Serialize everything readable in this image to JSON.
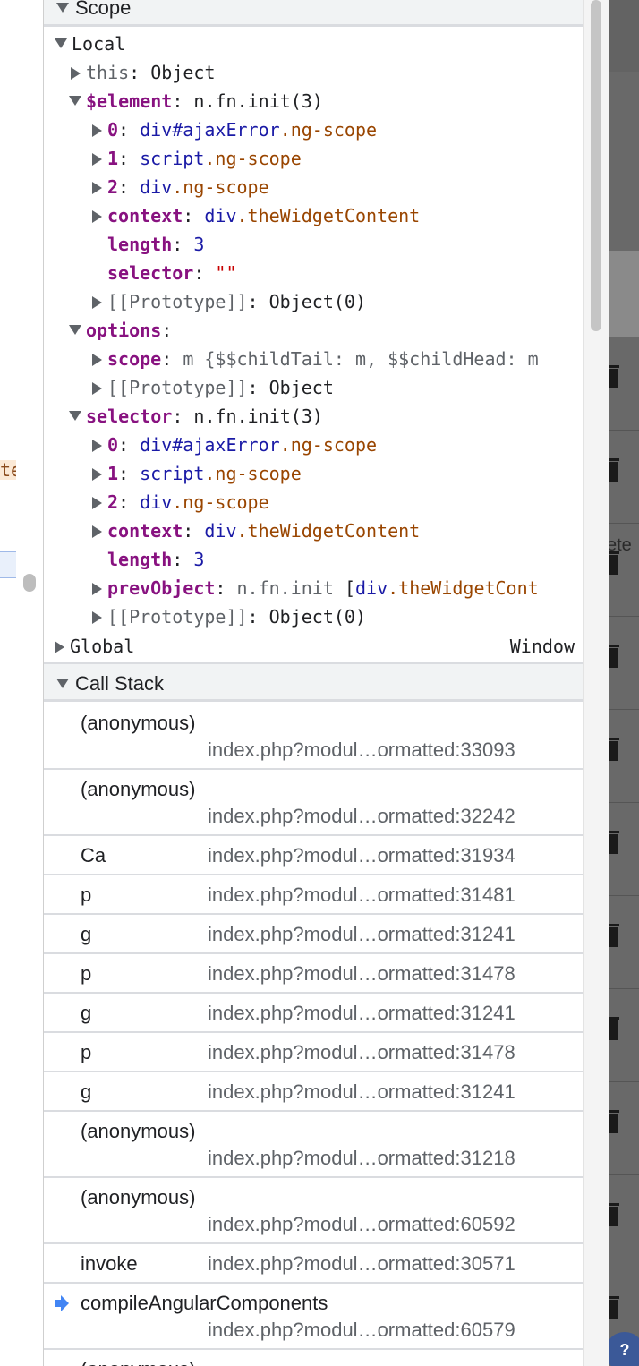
{
  "scope": {
    "title": "Scope",
    "local": {
      "label": "Local",
      "this": {
        "key": "this",
        "value": "Object"
      },
      "element": {
        "key": "$element",
        "value": "n.fn.init(3)",
        "children": [
          {
            "key": "0",
            "tag": "div",
            "id": "#ajaxError",
            "cls": ".ng-scope"
          },
          {
            "key": "1",
            "tag": "script",
            "cls": ".ng-scope"
          },
          {
            "key": "2",
            "tag": "div",
            "cls": ".ng-scope"
          },
          {
            "key": "context",
            "tag": "div",
            "cls": ".theWidgetContent"
          }
        ],
        "length": {
          "key": "length",
          "value": "3"
        },
        "selector": {
          "key": "selector",
          "value": "\"\""
        },
        "prototype": {
          "key": "[[Prototype]]",
          "value": "Object(0)"
        }
      },
      "options": {
        "key": "options",
        "scope": {
          "key": "scope",
          "value": "m {$$childTail: m, $$childHead: m"
        },
        "prototype": {
          "key": "[[Prototype]]",
          "value": "Object"
        }
      },
      "selector": {
        "key": "selector",
        "value": "n.fn.init(3)",
        "children": [
          {
            "key": "0",
            "tag": "div",
            "id": "#ajaxError",
            "cls": ".ng-scope"
          },
          {
            "key": "1",
            "tag": "script",
            "cls": ".ng-scope"
          },
          {
            "key": "2",
            "tag": "div",
            "cls": ".ng-scope"
          },
          {
            "key": "context",
            "tag": "div",
            "cls": ".theWidgetContent"
          }
        ],
        "length": {
          "key": "length",
          "value": "3"
        },
        "prevObject": {
          "key": "prevObject",
          "value": "n.fn.init",
          "bracket": "[",
          "tag": "div",
          "cls": ".theWidgetCont"
        },
        "prototype": {
          "key": "[[Prototype]]",
          "value": "Object(0)"
        }
      }
    },
    "global": {
      "label": "Global",
      "value": "Window"
    }
  },
  "call_stack": {
    "title": "Call Stack",
    "frames": [
      {
        "name": "(anonymous)",
        "location": "index.php?modul…ormatted:33093"
      },
      {
        "name": "(anonymous)",
        "location": "index.php?modul…ormatted:32242"
      },
      {
        "name": "Ca",
        "location": "index.php?modul…ormatted:31934"
      },
      {
        "name": "p",
        "location": "index.php?modul…ormatted:31481"
      },
      {
        "name": "g",
        "location": "index.php?modul…ormatted:31241"
      },
      {
        "name": "p",
        "location": "index.php?modul…ormatted:31478"
      },
      {
        "name": "g",
        "location": "index.php?modul…ormatted:31241"
      },
      {
        "name": "p",
        "location": "index.php?modul…ormatted:31478"
      },
      {
        "name": "g",
        "location": "index.php?modul…ormatted:31241"
      },
      {
        "name": "(anonymous)",
        "location": "index.php?modul…ormatted:31218"
      },
      {
        "name": "(anonymous)",
        "location": "index.php?modul…ormatted:60592"
      },
      {
        "name": "invoke",
        "location": "index.php?modul…ormatted:30571"
      },
      {
        "name": "compileAngularComponents",
        "location": "index.php?modul…ormatted:60579"
      },
      {
        "name": "(anonymous)",
        "location": ""
      }
    ]
  },
  "left_edge": {
    "fragment": "te"
  },
  "right_edge": {
    "fragment": "ete",
    "help_label": "?"
  },
  "colors": {
    "keyword": "#881280",
    "class": "#994500",
    "tag": "#1a1aa6",
    "string": "#c80000",
    "current_frame": "#4285f4"
  }
}
